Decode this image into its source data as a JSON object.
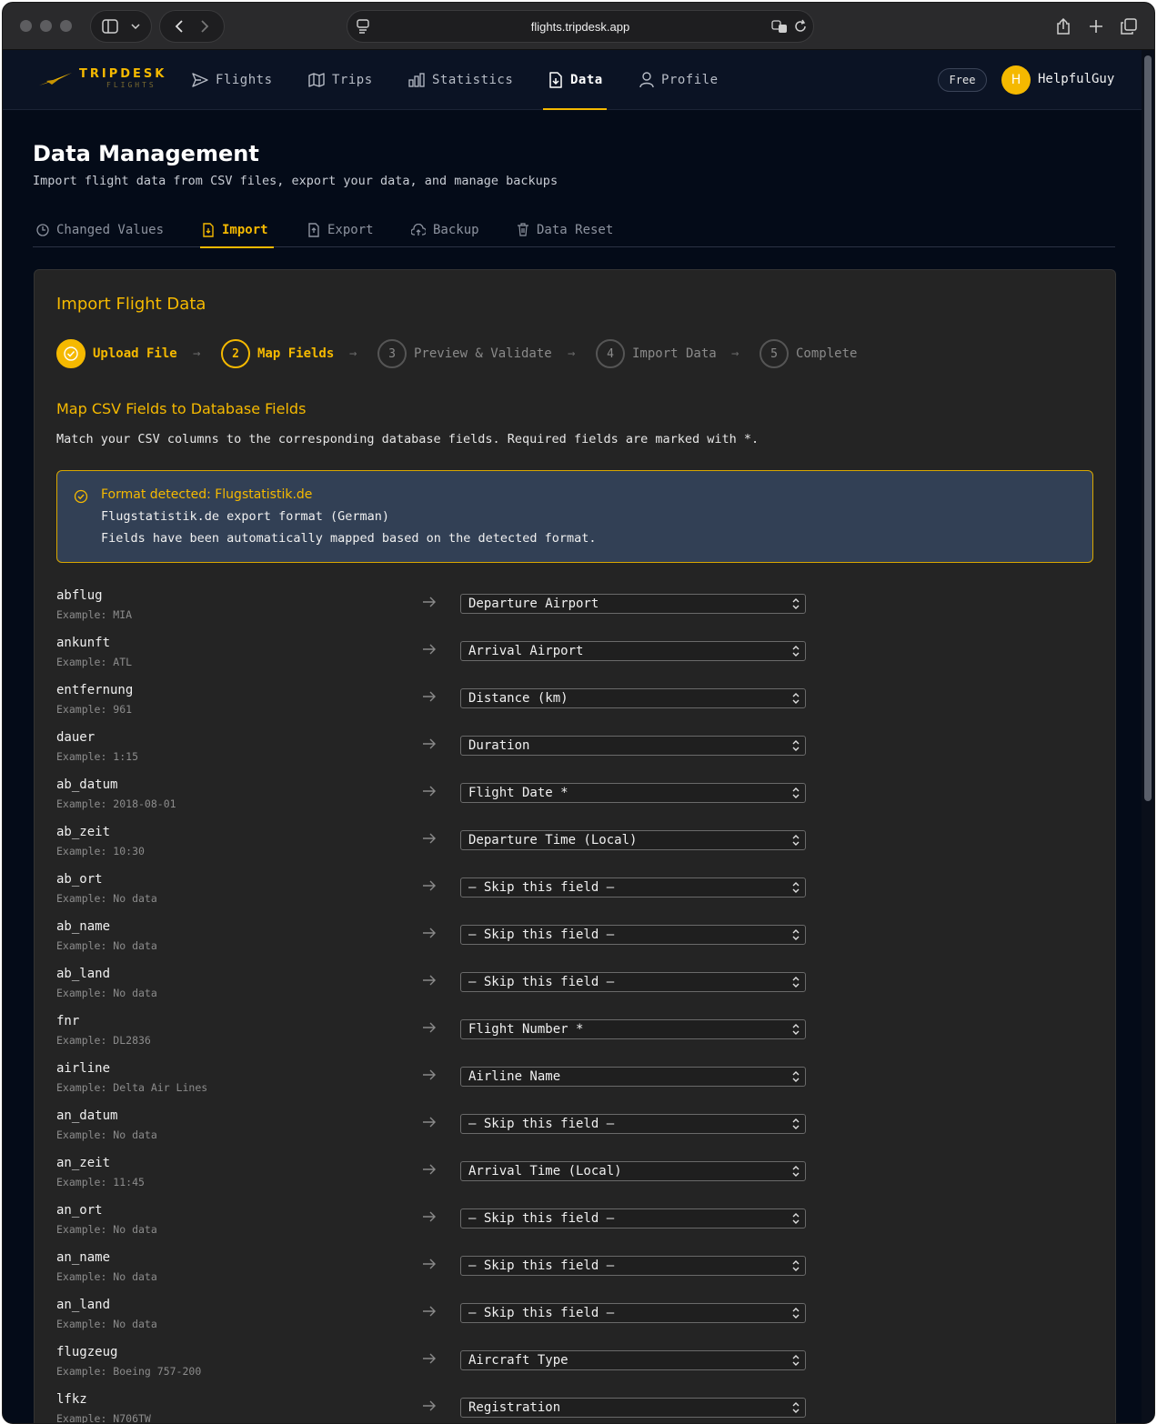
{
  "browser": {
    "url": "flights.tripdesk.app"
  },
  "app": {
    "logo_main": "TRIPDESK",
    "logo_sub": "FLIGHTS",
    "nav": [
      {
        "label": "Flights",
        "icon": "send-icon"
      },
      {
        "label": "Trips",
        "icon": "map-icon"
      },
      {
        "label": "Statistics",
        "icon": "bar-chart-icon"
      },
      {
        "label": "Data",
        "icon": "file-import-icon",
        "active": true
      },
      {
        "label": "Profile",
        "icon": "user-icon"
      }
    ],
    "plan": "Free",
    "avatar_initial": "H",
    "username": "HelpfulGuy"
  },
  "page": {
    "title": "Data Management",
    "subtitle": "Import flight data from CSV files, export your data, and manage backups",
    "tabs": [
      {
        "label": "Changed Values",
        "icon": "clock-icon"
      },
      {
        "label": "Import",
        "icon": "file-import-icon",
        "active": true
      },
      {
        "label": "Export",
        "icon": "file-export-icon"
      },
      {
        "label": "Backup",
        "icon": "cloud-upload-icon"
      },
      {
        "label": "Data Reset",
        "icon": "trash-icon"
      }
    ]
  },
  "import": {
    "title": "Import Flight Data",
    "steps": [
      {
        "label": "Upload File",
        "number": "1",
        "state": "done"
      },
      {
        "label": "Map Fields",
        "number": "2",
        "state": "current"
      },
      {
        "label": "Preview & Validate",
        "number": "3",
        "state": "pending"
      },
      {
        "label": "Import Data",
        "number": "4",
        "state": "pending"
      },
      {
        "label": "Complete",
        "number": "5",
        "state": "pending"
      }
    ],
    "section_title": "Map CSV Fields to Database Fields",
    "section_desc": "Match your CSV columns to the corresponding database fields. Required fields are marked with *.",
    "alert": {
      "title": "Format detected: Flugstatistik.de",
      "line1": "Flugstatistik.de export format (German)",
      "line2": "Fields have been automatically mapped based on the detected format."
    },
    "fields": [
      {
        "name": "abflug",
        "example": "Example: MIA",
        "mapped": "Departure Airport"
      },
      {
        "name": "ankunft",
        "example": "Example: ATL",
        "mapped": "Arrival Airport"
      },
      {
        "name": "entfernung",
        "example": "Example: 961",
        "mapped": "Distance (km)"
      },
      {
        "name": "dauer",
        "example": "Example: 1:15",
        "mapped": "Duration"
      },
      {
        "name": "ab_datum",
        "example": "Example: 2018-08-01",
        "mapped": "Flight Date *"
      },
      {
        "name": "ab_zeit",
        "example": "Example: 10:30",
        "mapped": "Departure Time (Local)"
      },
      {
        "name": "ab_ort",
        "example": "Example: No data",
        "mapped": "— Skip this field —"
      },
      {
        "name": "ab_name",
        "example": "Example: No data",
        "mapped": "— Skip this field —"
      },
      {
        "name": "ab_land",
        "example": "Example: No data",
        "mapped": "— Skip this field —"
      },
      {
        "name": "fnr",
        "example": "Example: DL2836",
        "mapped": "Flight Number *"
      },
      {
        "name": "airline",
        "example": "Example: Delta Air Lines",
        "mapped": "Airline Name"
      },
      {
        "name": "an_datum",
        "example": "Example: No data",
        "mapped": "— Skip this field —"
      },
      {
        "name": "an_zeit",
        "example": "Example: 11:45",
        "mapped": "Arrival Time (Local)"
      },
      {
        "name": "an_ort",
        "example": "Example: No data",
        "mapped": "— Skip this field —"
      },
      {
        "name": "an_name",
        "example": "Example: No data",
        "mapped": "— Skip this field —"
      },
      {
        "name": "an_land",
        "example": "Example: No data",
        "mapped": "— Skip this field —"
      },
      {
        "name": "flugzeug",
        "example": "Example: Boeing 757-200",
        "mapped": "Aircraft Type"
      },
      {
        "name": "lfkz",
        "example": "Example: N706TW",
        "mapped": "Registration"
      }
    ]
  },
  "colors": {
    "accent": "#f5b900",
    "background": "#040b18",
    "card": "#242424",
    "alert_bg": "#324055"
  }
}
